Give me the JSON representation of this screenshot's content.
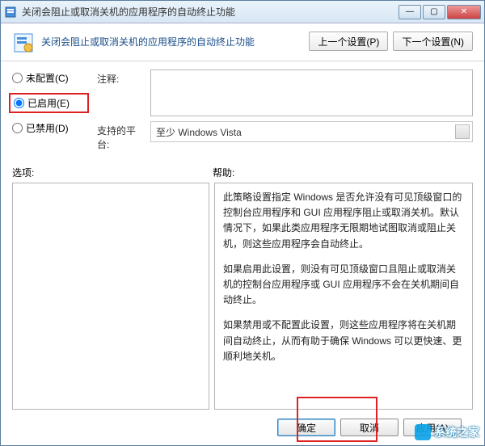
{
  "titlebar": {
    "title": "关闭会阻止或取消关机的应用程序的自动终止功能"
  },
  "header": {
    "title": "关闭会阻止或取消关机的应用程序的自动终止功能",
    "prev": "上一个设置(P)",
    "next": "下一个设置(N)"
  },
  "radios": {
    "not_configured": "未配置(C)",
    "enabled": "已启用(E)",
    "disabled": "已禁用(D)"
  },
  "fields": {
    "comment_label": "注释:",
    "platform_label": "支持的平台:",
    "platform_value": "至少 Windows Vista"
  },
  "labels": {
    "options": "选项:",
    "help": "帮助:"
  },
  "help": {
    "p1": "此策略设置指定 Windows 是否允许没有可见顶级窗口的控制台应用程序和 GUI 应用程序阻止或取消关机。默认情况下，如果此类应用程序无限期地试图取消或阻止关机，则这些应用程序会自动终止。",
    "p2": "如果启用此设置，则没有可见顶级窗口且阻止或取消关机的控制台应用程序或 GUI 应用程序不会在关机期间自动终止。",
    "p3": "如果禁用或不配置此设置，则这些应用程序将在关机期间自动终止，从而有助于确保 Windows 可以更快速、更顺利地关机。"
  },
  "footer": {
    "ok": "确定",
    "cancel": "取消",
    "apply": "应用(A)"
  },
  "watermark": "系统之家"
}
